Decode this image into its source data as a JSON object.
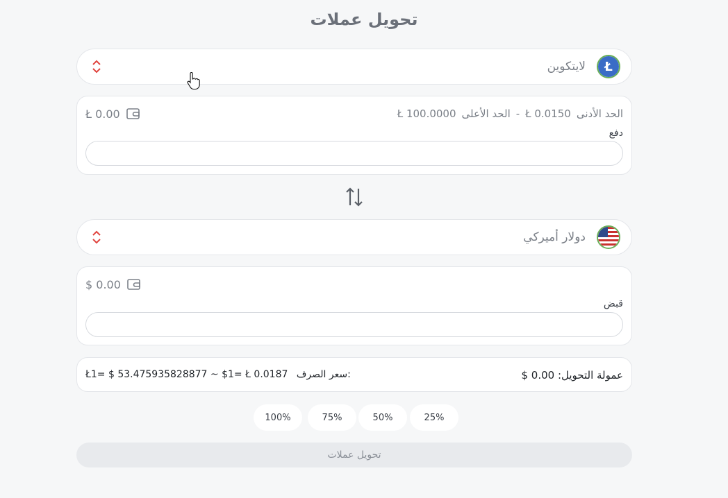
{
  "page": {
    "title": "تحويل عملات"
  },
  "from": {
    "currency_name": "لايتكوين",
    "coin_symbol": "Ł",
    "balance": "Ł 0.00",
    "limit_min_label": "الحد الأدنى",
    "limit_min_value": "Ł 0.0150",
    "limit_separator": "-",
    "limit_max_label": "الحد الأعلى",
    "limit_max_value": "Ł 100.0000",
    "field_label": "دفع",
    "input_value": ""
  },
  "to": {
    "currency_name": "دولار أميركي",
    "balance": "$ 0.00",
    "field_label": "قبض",
    "input_value": ""
  },
  "info": {
    "fee": "عمولة التحويل: 0.00 $",
    "rate_label": "سعر الصرف:",
    "rate_value": "Ł1= $ 53.475935828877 ~ $1= Ł 0.0187"
  },
  "percent_buttons": [
    "25%",
    "50%",
    "75%",
    "100%"
  ],
  "submit_label": "تحويل عملات",
  "colors": {
    "accent_red": "#e0443e",
    "coin_border": "#6aaf5a",
    "ltc_blue": "#3a6cc6"
  },
  "icons": {
    "selector_toggle": "chevron-up-down-icon",
    "wallet": "wallet-icon",
    "swap": "swap-arrows-icon",
    "cursor": "hand-pointer-icon"
  }
}
